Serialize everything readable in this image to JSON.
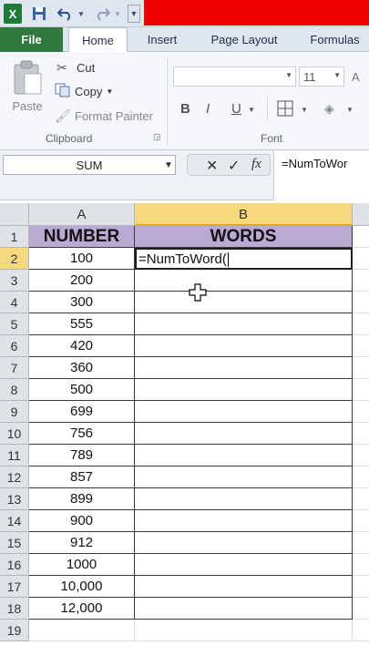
{
  "title_bar": {
    "excel_icon": "X",
    "save_icon": "save-icon",
    "undo_icon": "undo-icon",
    "redo_icon": "redo-icon",
    "customize_icon": "customize-qat-icon"
  },
  "tabs": [
    {
      "label": "File"
    },
    {
      "label": "Home"
    },
    {
      "label": "Insert"
    },
    {
      "label": "Page Layout"
    },
    {
      "label": "Formulas"
    }
  ],
  "ribbon": {
    "clipboard": {
      "paste_label": "Paste",
      "cut_label": "Cut",
      "copy_label": "Copy",
      "format_painter_label": "Format Painter",
      "group_label": "Clipboard"
    },
    "font": {
      "font_name": "",
      "font_size": "11",
      "bold": "B",
      "italic": "I",
      "underline": "U",
      "group_label": "Font"
    }
  },
  "formula_bar": {
    "name_box": "SUM",
    "cancel": "✕",
    "enter": "✓",
    "fx": "fx",
    "content": "=NumToWor"
  },
  "grid": {
    "columns": [
      "A",
      "B"
    ],
    "header_row": {
      "row": "1",
      "a": "NUMBER",
      "b": "WORDS"
    },
    "editing_text": "=NumToWord(",
    "rows": [
      {
        "row": "2",
        "a": "100"
      },
      {
        "row": "3",
        "a": "200"
      },
      {
        "row": "4",
        "a": "300"
      },
      {
        "row": "5",
        "a": "555"
      },
      {
        "row": "6",
        "a": "420"
      },
      {
        "row": "7",
        "a": "360"
      },
      {
        "row": "8",
        "a": "500"
      },
      {
        "row": "9",
        "a": "699"
      },
      {
        "row": "10",
        "a": "756"
      },
      {
        "row": "11",
        "a": "789"
      },
      {
        "row": "12",
        "a": "857"
      },
      {
        "row": "13",
        "a": "899"
      },
      {
        "row": "14",
        "a": "900"
      },
      {
        "row": "15",
        "a": "912"
      },
      {
        "row": "16",
        "a": "1000"
      },
      {
        "row": "17",
        "a": "10,000"
      },
      {
        "row": "18",
        "a": "12,000"
      },
      {
        "row": "19",
        "a": ""
      }
    ]
  },
  "colors": {
    "file_tab": "#2f7a3c",
    "header_fill": "#b9a9d3",
    "selected_header": "#f6d97c",
    "title_bar_accent": "#ee0000"
  }
}
